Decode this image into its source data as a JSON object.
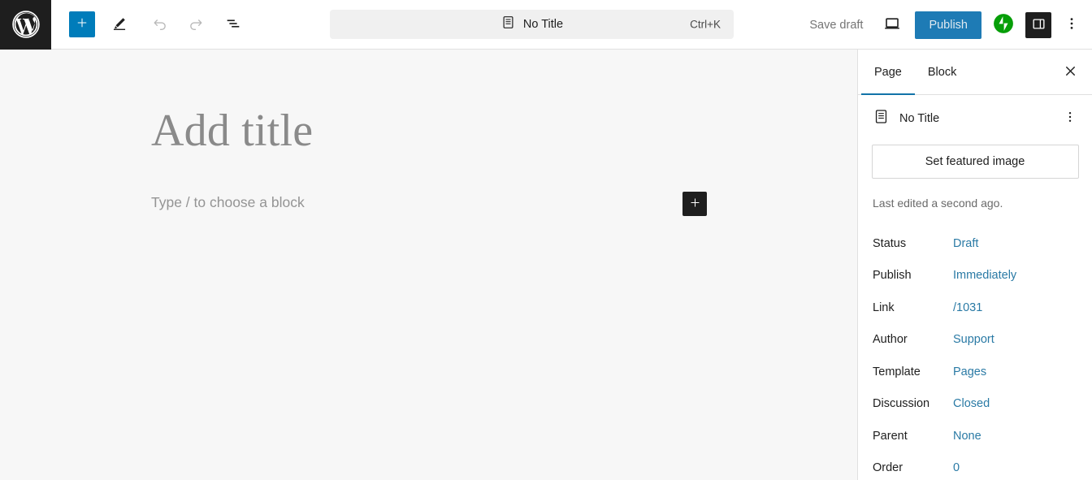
{
  "toolbar": {
    "logo_icon": "wordpress-logo-icon",
    "inserter_label": "+",
    "tools": [
      {
        "name": "block-inserter",
        "icon": "plus-icon"
      },
      {
        "name": "tools-pencil",
        "icon": "pencil-icon"
      },
      {
        "name": "undo",
        "icon": "undo-arrow-icon"
      },
      {
        "name": "redo",
        "icon": "redo-arrow-icon"
      },
      {
        "name": "document-overview",
        "icon": "list-view-icon"
      }
    ],
    "command_bar": {
      "icon": "page-document-icon",
      "title": "No Title",
      "shortcut": "Ctrl+K"
    },
    "save_draft_label": "Save draft",
    "preview_icon": "desktop-preview-icon",
    "publish_label": "Publish",
    "jetpack_icon": "jetpack-icon",
    "sidebar_toggle_icon": "settings-sidebar-icon",
    "more_menu_icon": "vertical-dots-icon"
  },
  "editor": {
    "title_placeholder": "Add title",
    "block_placeholder": "Type / to choose a block",
    "add_block_icon": "plus-icon"
  },
  "sidebar": {
    "tabs": [
      {
        "label": "Page",
        "active": true
      },
      {
        "label": "Block",
        "active": false
      }
    ],
    "close_icon": "close-x-icon",
    "document": {
      "icon": "page-document-icon",
      "name": "No Title",
      "more_icon": "vertical-dots-icon"
    },
    "featured_image_label": "Set featured image",
    "last_edited": "Last edited a second ago.",
    "meta": [
      {
        "label": "Status",
        "value": "Draft"
      },
      {
        "label": "Publish",
        "value": "Immediately"
      },
      {
        "label": "Link",
        "value": "/1031"
      },
      {
        "label": "Author",
        "value": "Support"
      },
      {
        "label": "Template",
        "value": "Pages"
      },
      {
        "label": "Discussion",
        "value": "Closed"
      },
      {
        "label": "Parent",
        "value": "None"
      },
      {
        "label": "Order",
        "value": "0"
      }
    ]
  },
  "colors": {
    "accent_blue": "#007cba",
    "publish_blue": "#1e7bb5",
    "link_blue": "#2a7aa5",
    "tab_underline": "#1173a8",
    "jetpack_green": "#069e08",
    "dark": "#1e1e1e",
    "canvas_bg": "#f7f7f7"
  }
}
